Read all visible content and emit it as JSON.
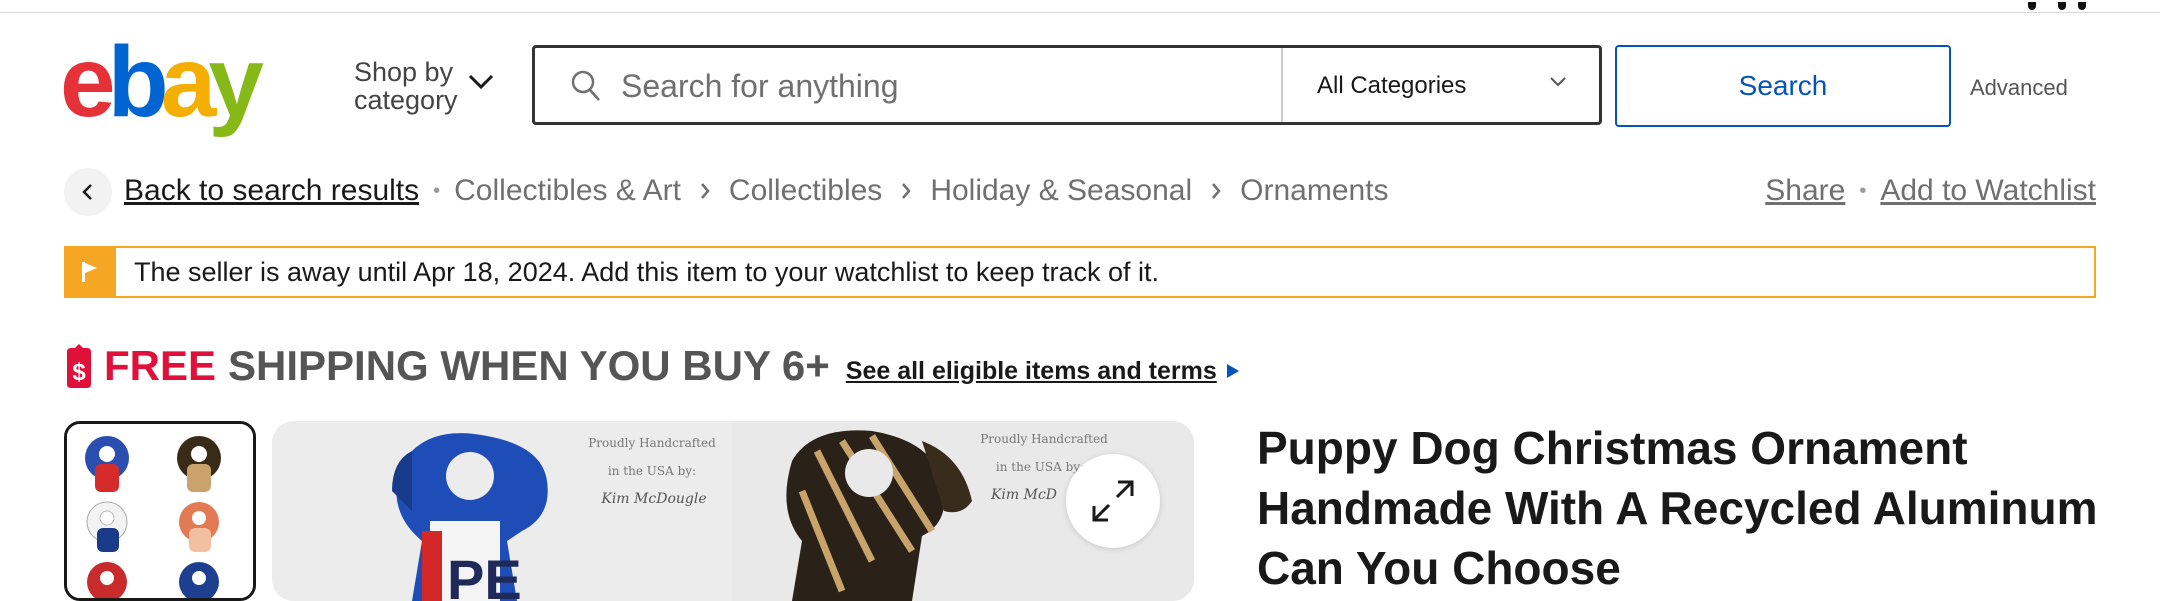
{
  "header": {
    "logo_letters": [
      "e",
      "b",
      "a",
      "y"
    ],
    "brand_colors": {
      "e": "#e53238",
      "b": "#0064d2",
      "a": "#f5af02",
      "y": "#86b817"
    },
    "shop_by_category": "Shop by category",
    "search": {
      "placeholder": "Search for anything",
      "value": ""
    },
    "category_select": "All Categories",
    "search_button": "Search",
    "advanced_link": "Advanced"
  },
  "breadcrumb": {
    "back_link": "Back to search results",
    "items": [
      "Collectibles & Art",
      "Collectibles",
      "Holiday & Seasonal",
      "Ornaments"
    ],
    "share": "Share",
    "watchlist": "Add to Watchlist"
  },
  "notice": {
    "message": "The seller is away until Apr 18, 2024. Add this item to your watchlist to keep track of it.",
    "accent_color": "#f5a623"
  },
  "promo": {
    "free": "FREE",
    "rest": "SHIPPING WHEN YOU BUY 6+",
    "link": "See all eligible items and terms",
    "free_color": "#e0103a"
  },
  "gallery": {
    "captions": [
      {
        "line1": "Proudly Handcrafted",
        "line2": "in the USA by:",
        "line3": "Kim McDougle"
      },
      {
        "line1": "Proudly Handcrafted",
        "line2": "in the USA by:",
        "line3": "Kim McD"
      }
    ],
    "can_text": "PE",
    "expand_icon": "expand-arrows-icon"
  },
  "product": {
    "title": "Puppy Dog Christmas Ornament Handmade With A Recycled Aluminum Can You Choose"
  }
}
